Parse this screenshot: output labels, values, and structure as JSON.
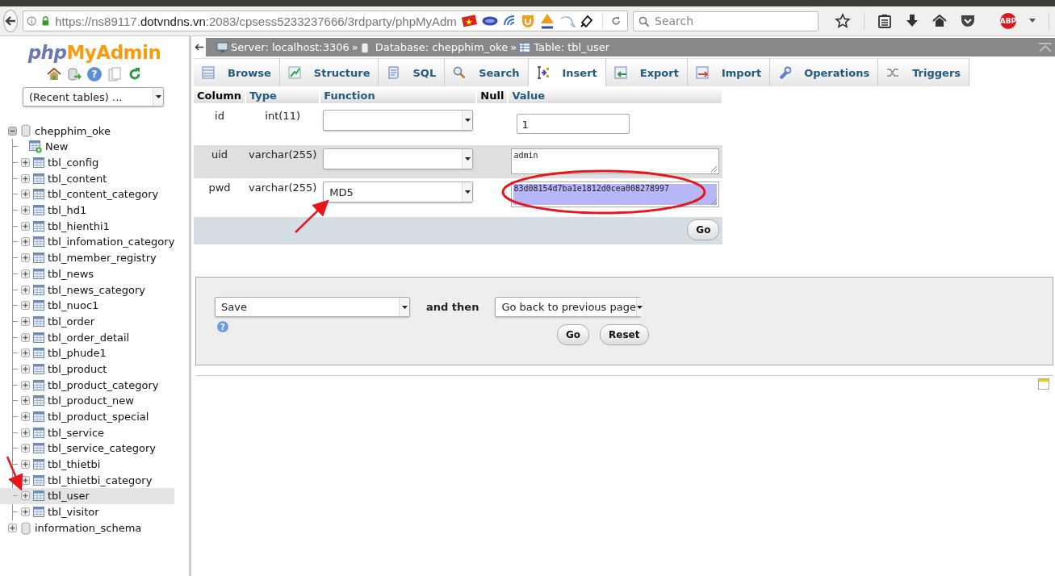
{
  "browser": {
    "url": {
      "prefix": "https://ns89117.",
      "domain": "dotvndns.vn",
      "rest": ":2083/cpsess5233237666/3rdparty/phpMyAdm"
    },
    "search": {
      "placeholder": "Search"
    },
    "adblock_badge": "ABP"
  },
  "sidebar": {
    "logo": {
      "php": "php",
      "myadmin": "MyAdmin"
    },
    "recent": "(Recent tables) ...",
    "tree": [
      {
        "name": "chepphim_oke",
        "expanded": true,
        "children": [
          {
            "name": "New",
            "kind": "new",
            "selected": false
          },
          {
            "name": "tbl_config",
            "kind": "table",
            "selected": false
          },
          {
            "name": "tbl_content",
            "kind": "table",
            "selected": false
          },
          {
            "name": "tbl_content_category",
            "kind": "table",
            "selected": false
          },
          {
            "name": "tbl_hd1",
            "kind": "table",
            "selected": false
          },
          {
            "name": "tbl_hienthi1",
            "kind": "table",
            "selected": false
          },
          {
            "name": "tbl_infomation_category",
            "kind": "table",
            "selected": false
          },
          {
            "name": "tbl_member_registry",
            "kind": "table",
            "selected": false
          },
          {
            "name": "tbl_news",
            "kind": "table",
            "selected": false
          },
          {
            "name": "tbl_news_category",
            "kind": "table",
            "selected": false
          },
          {
            "name": "tbl_nuoc1",
            "kind": "table",
            "selected": false
          },
          {
            "name": "tbl_order",
            "kind": "table",
            "selected": false
          },
          {
            "name": "tbl_order_detail",
            "kind": "table",
            "selected": false
          },
          {
            "name": "tbl_phude1",
            "kind": "table",
            "selected": false
          },
          {
            "name": "tbl_product",
            "kind": "table",
            "selected": false
          },
          {
            "name": "tbl_product_category",
            "kind": "table",
            "selected": false
          },
          {
            "name": "tbl_product_new",
            "kind": "table",
            "selected": false
          },
          {
            "name": "tbl_product_special",
            "kind": "table",
            "selected": false
          },
          {
            "name": "tbl_service",
            "kind": "table",
            "selected": false
          },
          {
            "name": "tbl_service_category",
            "kind": "table",
            "selected": false
          },
          {
            "name": "tbl_thietbi",
            "kind": "table",
            "selected": false
          },
          {
            "name": "tbl_thietbi_category",
            "kind": "table",
            "selected": false
          },
          {
            "name": "tbl_user",
            "kind": "table",
            "selected": true
          },
          {
            "name": "tbl_visitor",
            "kind": "table",
            "selected": false
          }
        ]
      },
      {
        "name": "information_schema",
        "expanded": false
      }
    ],
    "help_glyph": "?"
  },
  "breadcrumb": [
    {
      "kind": "server",
      "text": "Server: localhost:3306"
    },
    {
      "kind": "sep",
      "text": "»"
    },
    {
      "kind": "database",
      "text": "Database: chepphim_oke"
    },
    {
      "kind": "sep",
      "text": "»"
    },
    {
      "kind": "table",
      "text": "Table: tbl_user"
    }
  ],
  "tabs": [
    {
      "label": "Browse",
      "kind": "browse",
      "selected": false
    },
    {
      "label": "Structure",
      "kind": "structure",
      "selected": false
    },
    {
      "label": "SQL",
      "kind": "sql",
      "selected": false
    },
    {
      "label": "Search",
      "kind": "search",
      "selected": false
    },
    {
      "label": "Insert",
      "kind": "insert",
      "selected": true
    },
    {
      "label": "Export",
      "kind": "export",
      "selected": false
    },
    {
      "label": "Import",
      "kind": "import",
      "selected": false
    },
    {
      "label": "Operations",
      "kind": "operations",
      "selected": false
    },
    {
      "label": "Triggers",
      "kind": "triggers",
      "selected": false
    }
  ],
  "table": {
    "columns": [
      "Column",
      "Type",
      "Function",
      "Null",
      "Value"
    ],
    "rows": [
      {
        "column": "id",
        "type": "int(11)",
        "function": "",
        "kind": "input",
        "value": "1",
        "highlighted": false
      },
      {
        "column": "uid",
        "type": "varchar(255)",
        "function": "",
        "kind": "textarea",
        "value": "admin",
        "highlighted": false
      },
      {
        "column": "pwd",
        "type": "varchar(255)",
        "function": "MD5",
        "kind": "textarea",
        "value": "83d08154d7ba1e1812d0cea008278997",
        "highlighted": true
      }
    ],
    "go_button": "Go"
  },
  "save_panel": {
    "help_glyph": "?",
    "action": "Save",
    "and_then": "and then",
    "after": "Go back to previous page",
    "buttons": [
      "Go",
      "Reset"
    ]
  }
}
